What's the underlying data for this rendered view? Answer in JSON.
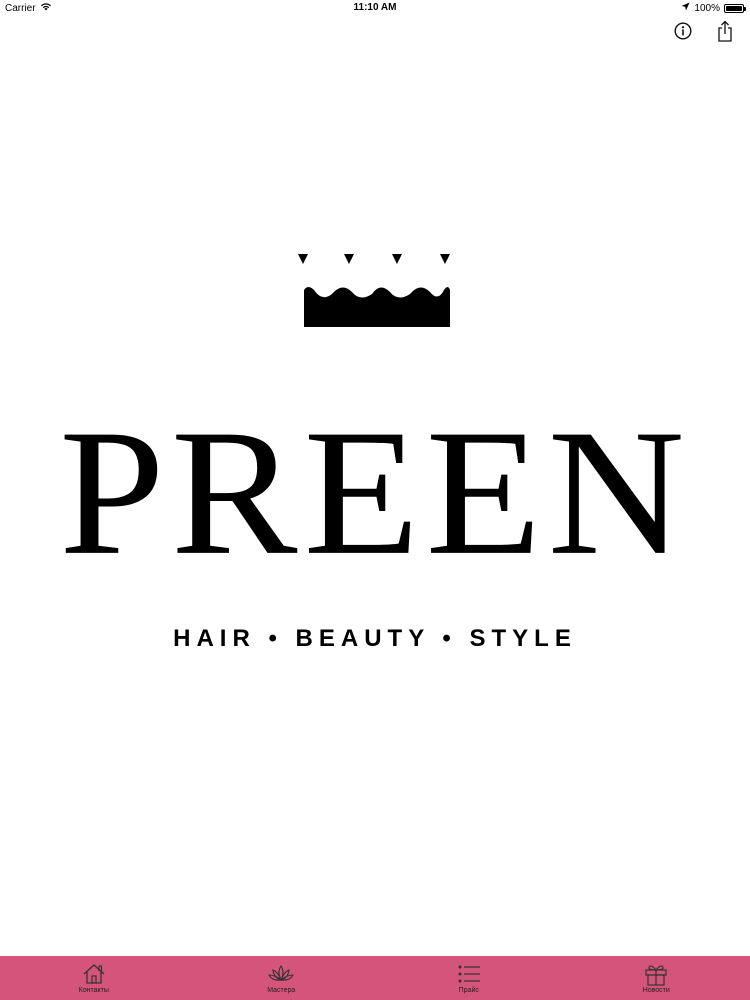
{
  "status_bar": {
    "carrier": "Carrier",
    "time": "11:10 AM",
    "battery": "100%",
    "battery_level": 1.0
  },
  "top_actions": {
    "info_icon": "info-icon",
    "share_icon": "share-icon"
  },
  "logo": {
    "brand": "PREEN",
    "tagline": "HAIR • BEAUTY • STYLE"
  },
  "tab_bar": {
    "background": "#d4547c",
    "items": [
      {
        "label": "Контакты",
        "icon": "home-icon"
      },
      {
        "label": "Мастера",
        "icon": "lotus-icon"
      },
      {
        "label": "Прайс",
        "icon": "list-icon"
      },
      {
        "label": "Новости",
        "icon": "gift-icon"
      }
    ]
  }
}
